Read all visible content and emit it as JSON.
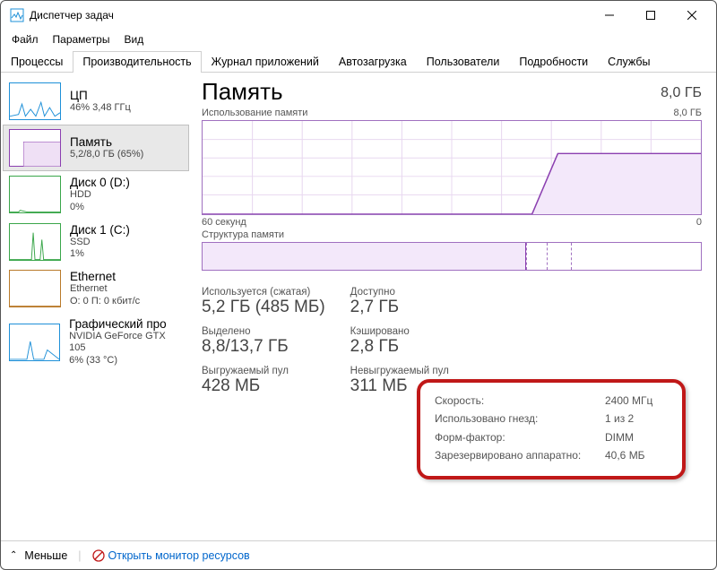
{
  "window": {
    "title": "Диспетчер задач"
  },
  "menu": {
    "file": "Файл",
    "options": "Параметры",
    "view": "Вид"
  },
  "tabs": {
    "processes": "Процессы",
    "performance": "Производительность",
    "apphistory": "Журнал приложений",
    "startup": "Автозагрузка",
    "users": "Пользователи",
    "details": "Подробности",
    "services": "Службы"
  },
  "sidebar": {
    "cpu": {
      "title": "ЦП",
      "sub": "46% 3,48 ГГц",
      "color": "#1e90d8"
    },
    "memory": {
      "title": "Память",
      "sub": "5,2/8,0 ГБ (65%)",
      "color": "#8b3fb0"
    },
    "disk0": {
      "title": "Диск 0 (D:)",
      "sub1": "HDD",
      "sub2": "0%",
      "color": "#3aa64a"
    },
    "disk1": {
      "title": "Диск 1 (C:)",
      "sub1": "SSD",
      "sub2": "1%",
      "color": "#3aa64a"
    },
    "eth": {
      "title": "Ethernet",
      "sub1": "Ethernet",
      "sub2": "О: 0 П: 0 кбит/с",
      "color": "#b97a2a"
    },
    "gpu": {
      "title": "Графический про",
      "sub1": "NVIDIA GeForce GTX 105",
      "sub2": "6%  (33 °C)",
      "color": "#1e90d8"
    }
  },
  "main": {
    "title": "Память",
    "total": "8,0 ГБ",
    "usage_label": "Использование памяти",
    "usage_max": "8,0 ГБ",
    "x_left": "60 секунд",
    "x_right": "0",
    "struct_label": "Структура памяти",
    "stats": {
      "used_lbl": "Используется (сжатая)",
      "used_val": "5,2 ГБ (485 МБ)",
      "avail_lbl": "Доступно",
      "avail_val": "2,7 ГБ",
      "commit_lbl": "Выделено",
      "commit_val": "8,8/13,7 ГБ",
      "cached_lbl": "Кэшировано",
      "cached_val": "2,8 ГБ",
      "paged_lbl": "Выгружаемый пул",
      "paged_val": "428 МБ",
      "nonpaged_lbl": "Невыгружаемый пул",
      "nonpaged_val": "311 МБ"
    },
    "info": {
      "speed_k": "Скорость:",
      "speed_v": "2400 МГц",
      "slots_k": "Использовано гнезд:",
      "slots_v": "1 из 2",
      "form_k": "Форм-фактор:",
      "form_v": "DIMM",
      "hw_k": "Зарезервировано аппаратно:",
      "hw_v": "40,6 МБ"
    }
  },
  "footer": {
    "less": "Меньше",
    "resmon": "Открыть монитор ресурсов"
  },
  "chart_data": {
    "type": "line",
    "title": "Использование памяти",
    "xlabel": "60 секунд",
    "ylabel": "",
    "ylim": [
      0,
      8.0
    ],
    "x": [
      0,
      40,
      43,
      60
    ],
    "series": [
      {
        "name": "Память",
        "values": [
          0,
          0,
          5.2,
          5.2
        ]
      }
    ]
  }
}
